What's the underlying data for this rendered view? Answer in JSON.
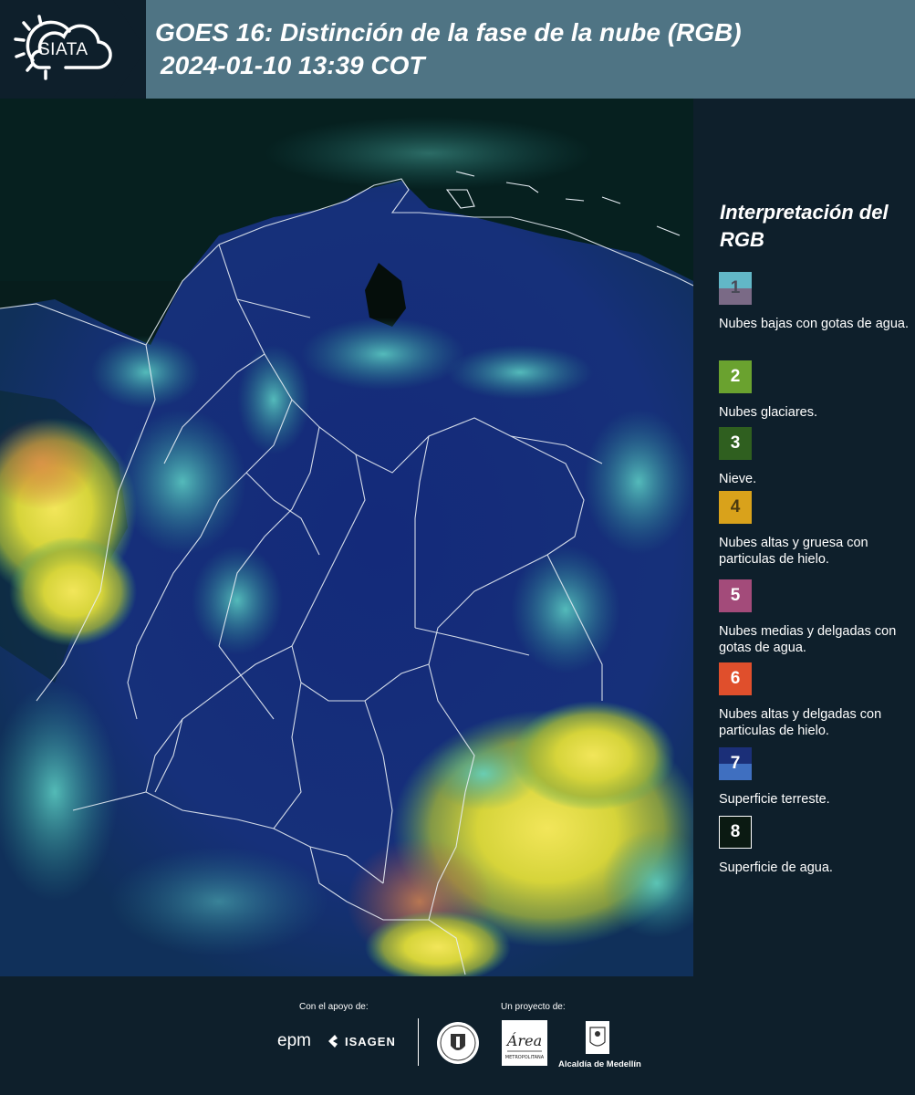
{
  "header": {
    "logo_text": "SIATA",
    "title_line1": "GOES 16: Distinción de la fase de la nube (RGB)",
    "title_line2": "2024-01-10 13:39 COT",
    "bg_color": "#4f7484"
  },
  "legend": {
    "title": "Interpretación del RGB",
    "items": [
      {
        "number": "1",
        "label": "Nubes bajas con gotas de agua.",
        "color_top": "#62b7c7",
        "color_bottom": "#7a6a86"
      },
      {
        "number": "2",
        "label": "Nubes glaciares.",
        "color_top": "#6aa22f",
        "color_bottom": "#6aa22f"
      },
      {
        "number": "3",
        "label": "Nieve.",
        "color_top": "#2f5f1f",
        "color_bottom": "#2f5f1f"
      },
      {
        "number": "4",
        "label": "Nubes altas y gruesa con particulas de hielo.",
        "color_top": "#d9a21b",
        "color_bottom": "#d9a21b"
      },
      {
        "number": "5",
        "label": "Nubes medias y delgadas con gotas de agua.",
        "color_top": "#a34b7a",
        "color_bottom": "#a34b7a"
      },
      {
        "number": "6",
        "label": "Nubes altas y delgadas con particulas de hielo.",
        "color_top": "#e04f2c",
        "color_bottom": "#e04f2c"
      },
      {
        "number": "7",
        "label": "Superficie terreste.",
        "color_top": "#1b2f78",
        "color_bottom": "#3f6fc0"
      },
      {
        "number": "8",
        "label": "Superficie de agua.",
        "color_top": "#0b1a12",
        "color_bottom": "#0b1a12"
      }
    ]
  },
  "footer": {
    "support_label": "Con el apoyo de:",
    "project_label": "Un proyecto de:",
    "sponsor_epm": "epm",
    "sponsor_isagen": "ISAGEN",
    "partner_area": "Área Metropolitana Valle de Aburrá",
    "partner_alcaldia": "Alcaldía de Medellín"
  }
}
